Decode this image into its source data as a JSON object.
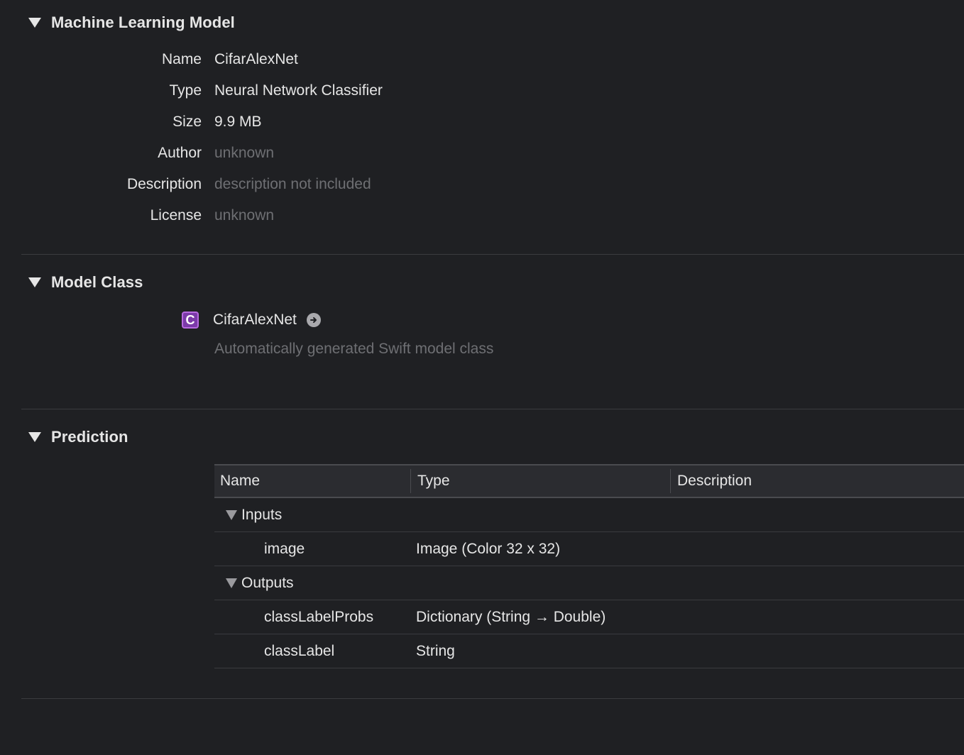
{
  "sections": {
    "ml_model": {
      "title": "Machine Learning Model",
      "properties": [
        {
          "label": "Name",
          "value": "CifarAlexNet"
        },
        {
          "label": "Type",
          "value": "Neural Network Classifier"
        },
        {
          "label": "Size",
          "value": "9.9 MB"
        },
        {
          "label": "Author",
          "value": "unknown"
        },
        {
          "label": "Description",
          "value": "description not included"
        },
        {
          "label": "License",
          "value": "unknown"
        }
      ]
    },
    "model_class": {
      "title": "Model Class",
      "badge": "C",
      "class_name": "CifarAlexNet",
      "description": "Automatically generated Swift model class"
    },
    "prediction": {
      "title": "Prediction",
      "columns": [
        "Name",
        "Type",
        "Description"
      ],
      "groups": [
        {
          "label": "Inputs",
          "rows": [
            {
              "name": "image",
              "type": "Image (Color 32 x 32)",
              "description": ""
            }
          ]
        },
        {
          "label": "Outputs",
          "rows": [
            {
              "name": "classLabelProbs",
              "type": "Dictionary (String → Double)",
              "description": ""
            },
            {
              "name": "classLabel",
              "type": "String",
              "description": ""
            }
          ]
        }
      ]
    }
  },
  "colors": {
    "background": "#1f2023",
    "text": "#e6e6e6",
    "muted_text": "#6e6f73",
    "class_badge": "#7b3aa8",
    "divider": "#3a3b3f"
  }
}
